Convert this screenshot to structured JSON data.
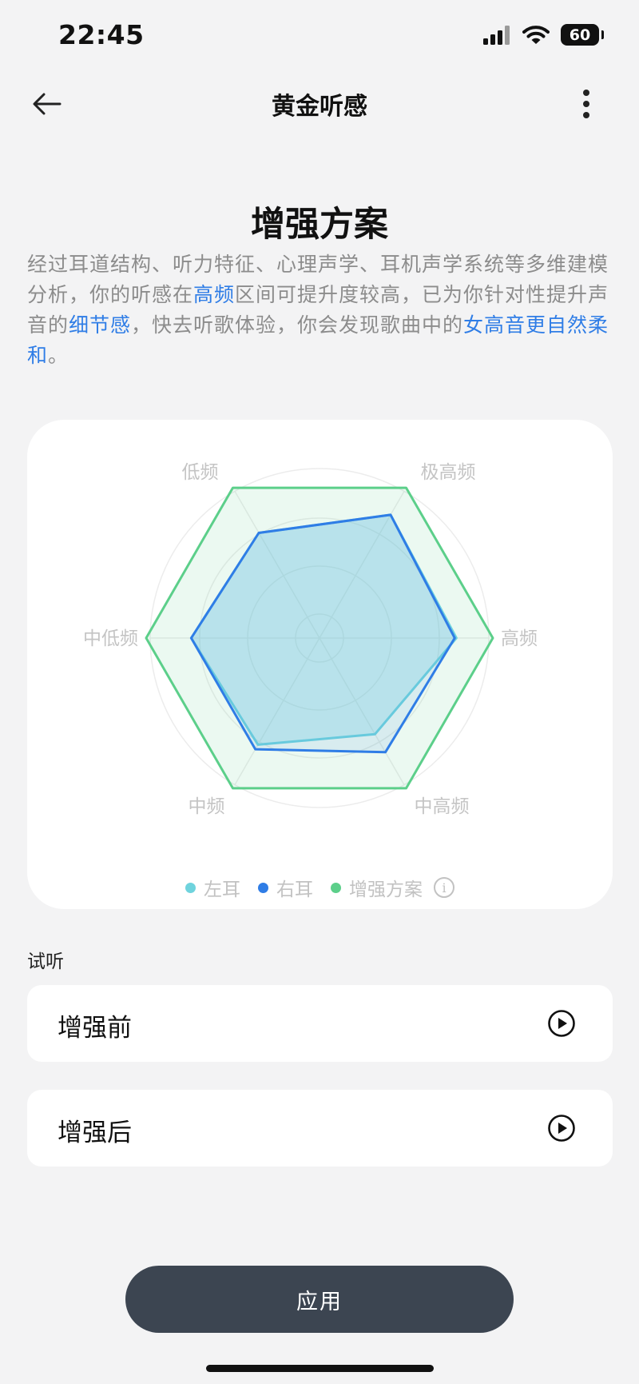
{
  "status_bar": {
    "time": "22:45",
    "battery": "60"
  },
  "nav": {
    "title": "黄金听感"
  },
  "heading": "增强方案",
  "description": {
    "part1": "经过耳道结构、听力特征、心理声学、耳机声学系统等多维建模分析，你的听感在",
    "highlight1": "高频",
    "part2": "区间可提升度较高，已为你针对性提升声音的",
    "highlight2": "细节感",
    "part3": "，快去听歌体验，你会发现歌曲中的",
    "highlight3": "女高音更自然柔和",
    "part4": "。"
  },
  "chart_data": {
    "type": "radar",
    "axes": [
      "极高频",
      "高频",
      "中高频",
      "中频",
      "中低频",
      "低频"
    ],
    "range": [
      0,
      1
    ],
    "grid": "circular",
    "series": [
      {
        "name": "左耳",
        "color": "#6fd3dd",
        "values": [
          0.82,
          0.79,
          0.64,
          0.71,
          0.74,
          0.7
        ]
      },
      {
        "name": "右耳",
        "color": "#2f7de6",
        "values": [
          0.82,
          0.78,
          0.76,
          0.74,
          0.74,
          0.7
        ]
      },
      {
        "name": "增强方案",
        "color": "#5ccf8a",
        "values": [
          1.0,
          1.0,
          1.0,
          1.0,
          1.0,
          1.0
        ]
      }
    ],
    "legend": "bottom"
  },
  "preview": {
    "label": "试听",
    "before": "增强前",
    "after": "增强后"
  },
  "apply_label": "应用",
  "colors": {
    "accent": "#2f7de6",
    "apply_button": "#3c4551"
  }
}
